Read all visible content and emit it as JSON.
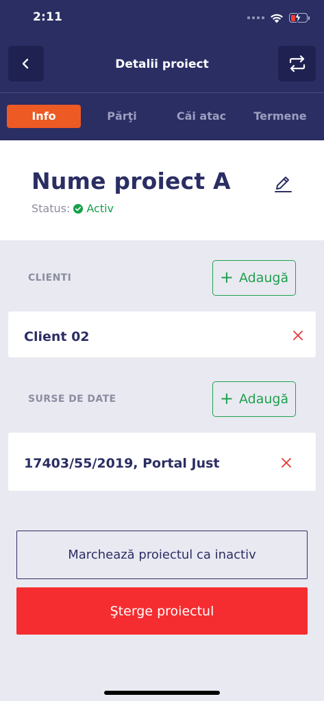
{
  "status_bar": {
    "time": "2:11"
  },
  "nav": {
    "title": "Detalii proiect",
    "back_icon": "chevron-left-icon",
    "switch_icon": "switch-arrows-icon"
  },
  "tabs": [
    {
      "label": "Info",
      "active": true
    },
    {
      "label": "Părţi",
      "active": false
    },
    {
      "label": "Căi atac",
      "active": false
    },
    {
      "label": "Termene",
      "active": false
    }
  ],
  "project": {
    "name": "Nume proiect A",
    "status_label": "Status:",
    "status_value": "Activ"
  },
  "clients": {
    "label": "CLIENTI",
    "add_label": "Adaugă",
    "items": [
      {
        "text": "Client 02"
      }
    ]
  },
  "sources": {
    "label": "SURSE DE DATE",
    "add_label": "Adaugă",
    "items": [
      {
        "text": "17403/55/2019, Portal Just"
      }
    ]
  },
  "actions": {
    "mark_inactive_label": "Marchează proiectul ca inactiv",
    "delete_label": "Şterge proiectul"
  },
  "colors": {
    "header_bg": "#2b2e63",
    "accent_orange": "#ee5a24",
    "success_green": "#1ea04c",
    "danger_red": "#f52d30"
  }
}
